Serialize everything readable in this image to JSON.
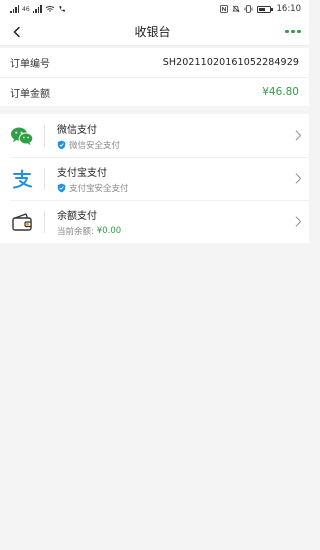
{
  "status_bar": {
    "left_text": "46",
    "time": "16:10",
    "icons": [
      "signal-icon",
      "signal-icon",
      "wifi-icon",
      "call-icon",
      "nfc-icon",
      "mute-icon",
      "vibrate-icon",
      "battery-icon"
    ]
  },
  "nav": {
    "title": "收银台",
    "back_icon": "chevron-left-icon",
    "more_icon": "more-dots-icon"
  },
  "order": {
    "number_label": "订单编号",
    "number_value": "SH20211020161052284929",
    "amount_label": "订单金额",
    "amount_value": "¥46.80"
  },
  "payment_methods": [
    {
      "title": "微信支付",
      "subtitle": "微信安全支付",
      "icon": "wechat-pay-icon",
      "badge_icon": "shield-check-icon"
    },
    {
      "title": "支付宝支付",
      "subtitle": "支付宝安全支付",
      "icon": "alipay-icon",
      "badge_icon": "shield-check-icon"
    },
    {
      "title": "余额支付",
      "subtitle_label": "当前余额:",
      "balance_value": "¥0.00",
      "icon": "wallet-icon"
    }
  ],
  "colors": {
    "accent": "#2fa044",
    "alipay_blue": "#1f8fe8",
    "background": "#f4f4f4"
  }
}
